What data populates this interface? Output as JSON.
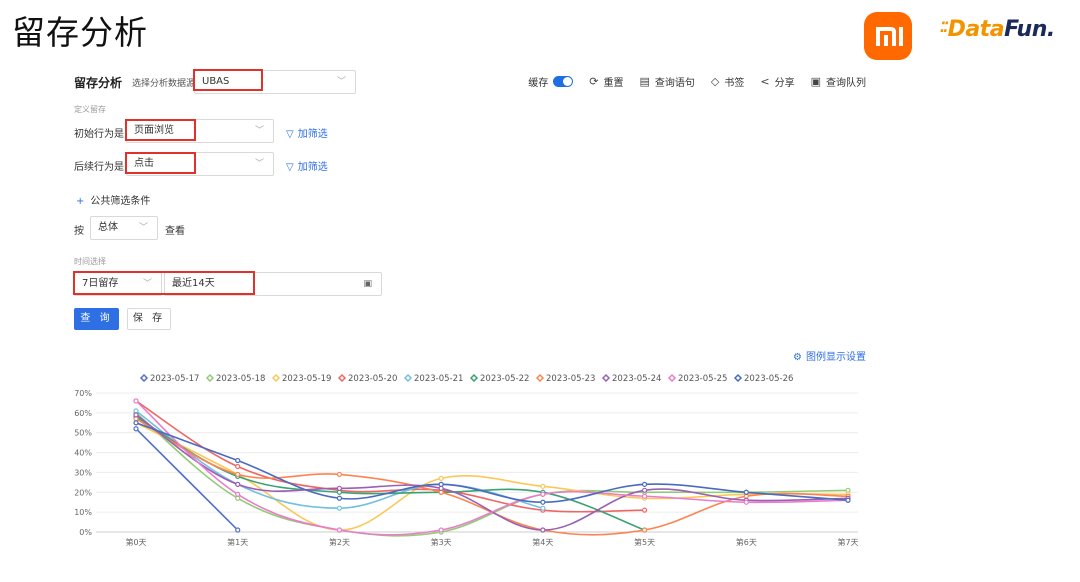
{
  "slide": {
    "title": "留存分析"
  },
  "logos": {
    "brand1": "mi",
    "brand2_prefix": "Data",
    "brand2_suffix": "Fun."
  },
  "header": {
    "title": "留存分析",
    "datasource_label": "选择分析数据源:",
    "datasource_value": "UBAS"
  },
  "toolbar": {
    "cache_label": "缓存",
    "cache_on": true,
    "reset_label": "重置",
    "query_stmt_label": "查询语句",
    "bookmark_label": "书签",
    "share_label": "分享",
    "queue_label": "查询队列"
  },
  "define": {
    "caption": "定义留存",
    "initial_label": "初始行为是",
    "initial_value": "页面浏览",
    "followup_label": "后续行为是",
    "followup_value": "点击",
    "add_filter": "加筛选",
    "common_filter": "公共筛选条件",
    "by_label": "按",
    "by_value": "总体",
    "view_label": "查看"
  },
  "time": {
    "caption": "时间选择",
    "period_value": "7日留存",
    "range_value": "最近14天"
  },
  "actions": {
    "query": "查 询",
    "save": "保 存"
  },
  "legend_settings": "图例显示设置",
  "chart_data": {
    "type": "line",
    "categories": [
      "第0天",
      "第1天",
      "第2天",
      "第3天",
      "第4天",
      "第5天",
      "第6天",
      "第7天"
    ],
    "ylim": [
      0,
      70
    ],
    "yticks": [
      "0%",
      "10%",
      "20%",
      "30%",
      "40%",
      "50%",
      "60%",
      "70%"
    ],
    "grid": true,
    "legend_position": "top",
    "series": [
      {
        "name": "2023-05-17",
        "color": "#5470c6",
        "values": [
          52,
          1,
          null,
          null,
          null,
          null,
          null,
          null
        ]
      },
      {
        "name": "2023-05-18",
        "color": "#91cc75",
        "values": [
          60,
          17,
          1,
          0,
          19,
          20,
          20,
          21
        ]
      },
      {
        "name": "2023-05-19",
        "color": "#fac858",
        "values": [
          55,
          29,
          1,
          27,
          23,
          17,
          19,
          19
        ]
      },
      {
        "name": "2023-05-20",
        "color": "#ee6666",
        "values": [
          66,
          33,
          21,
          21,
          11,
          11,
          null,
          null
        ]
      },
      {
        "name": "2023-05-21",
        "color": "#73c0de",
        "values": [
          61,
          24,
          12,
          24,
          12,
          null,
          null,
          null
        ]
      },
      {
        "name": "2023-05-22",
        "color": "#3ba272",
        "values": [
          58,
          28,
          20,
          20,
          20,
          1,
          null,
          null
        ]
      },
      {
        "name": "2023-05-23",
        "color": "#fc8452",
        "values": [
          57,
          29,
          29,
          20,
          1,
          1,
          18,
          18
        ]
      },
      {
        "name": "2023-05-24",
        "color": "#9a60b4",
        "values": [
          59,
          24,
          22,
          22,
          1,
          21,
          16,
          17
        ]
      },
      {
        "name": "2023-05-25",
        "color": "#ea7ccc",
        "values": [
          66,
          19,
          1,
          1,
          19,
          18,
          15,
          16
        ]
      },
      {
        "name": "2023-05-26",
        "color": "#4b6bbf",
        "values": [
          55,
          36,
          17,
          24,
          15,
          24,
          20,
          16
        ]
      }
    ]
  }
}
